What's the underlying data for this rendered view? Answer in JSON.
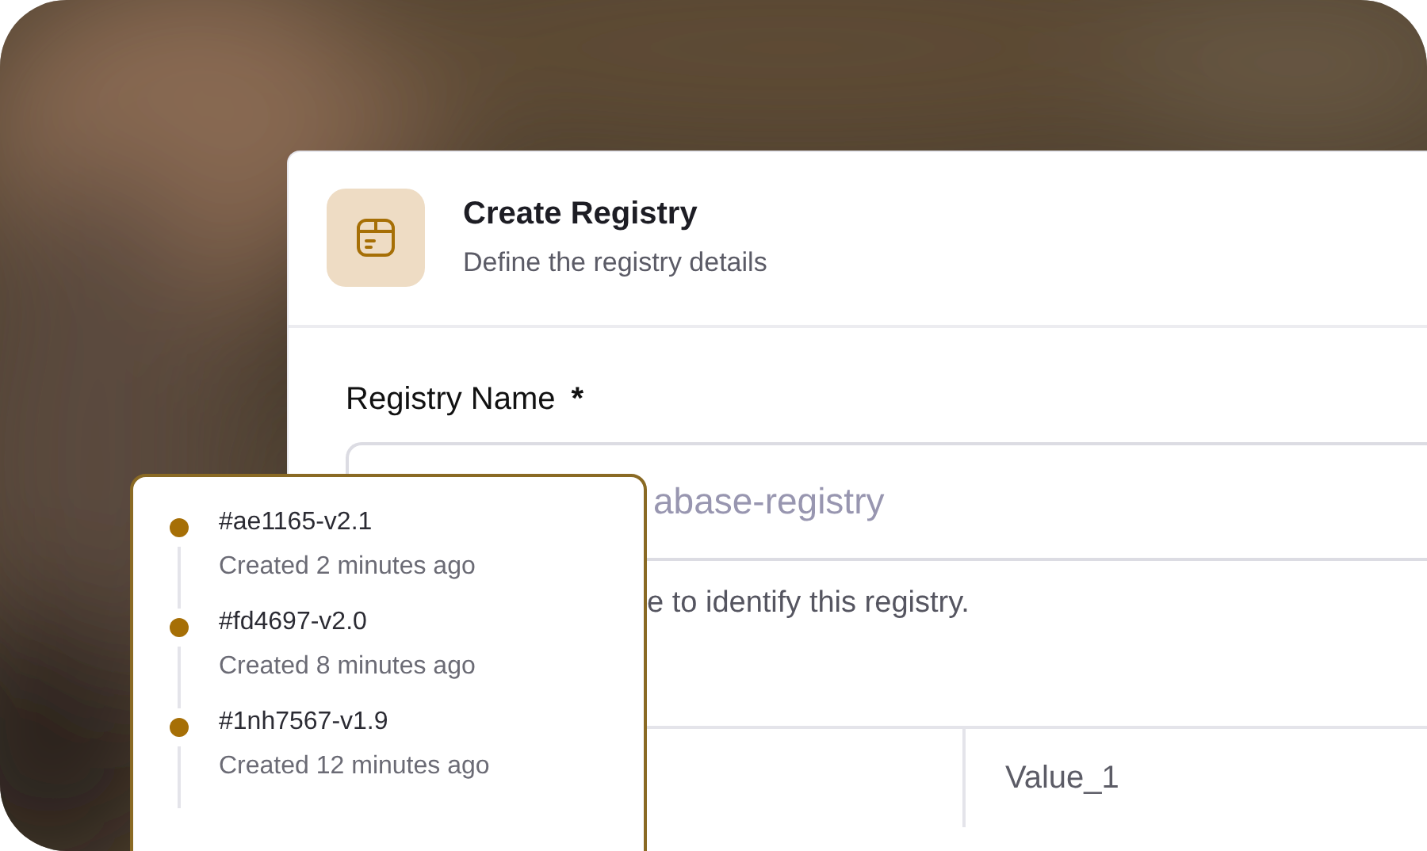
{
  "dialog": {
    "title": "Create Registry",
    "subtitle": "Define the registry details"
  },
  "form": {
    "label": "Registry Name",
    "required_mark": "*",
    "placeholder": "abase-registry",
    "helper": "e to identify this registry."
  },
  "table_row": {
    "column_2": "Value_1"
  },
  "versions": [
    {
      "tag": "#ae1165-v2.1",
      "created": "Created 2 minutes ago"
    },
    {
      "tag": "#fd4697-v2.0",
      "created": "Created 8 minutes ago"
    },
    {
      "tag": "#1nh7567-v1.9",
      "created": "Created 12 minutes ago"
    }
  ]
}
